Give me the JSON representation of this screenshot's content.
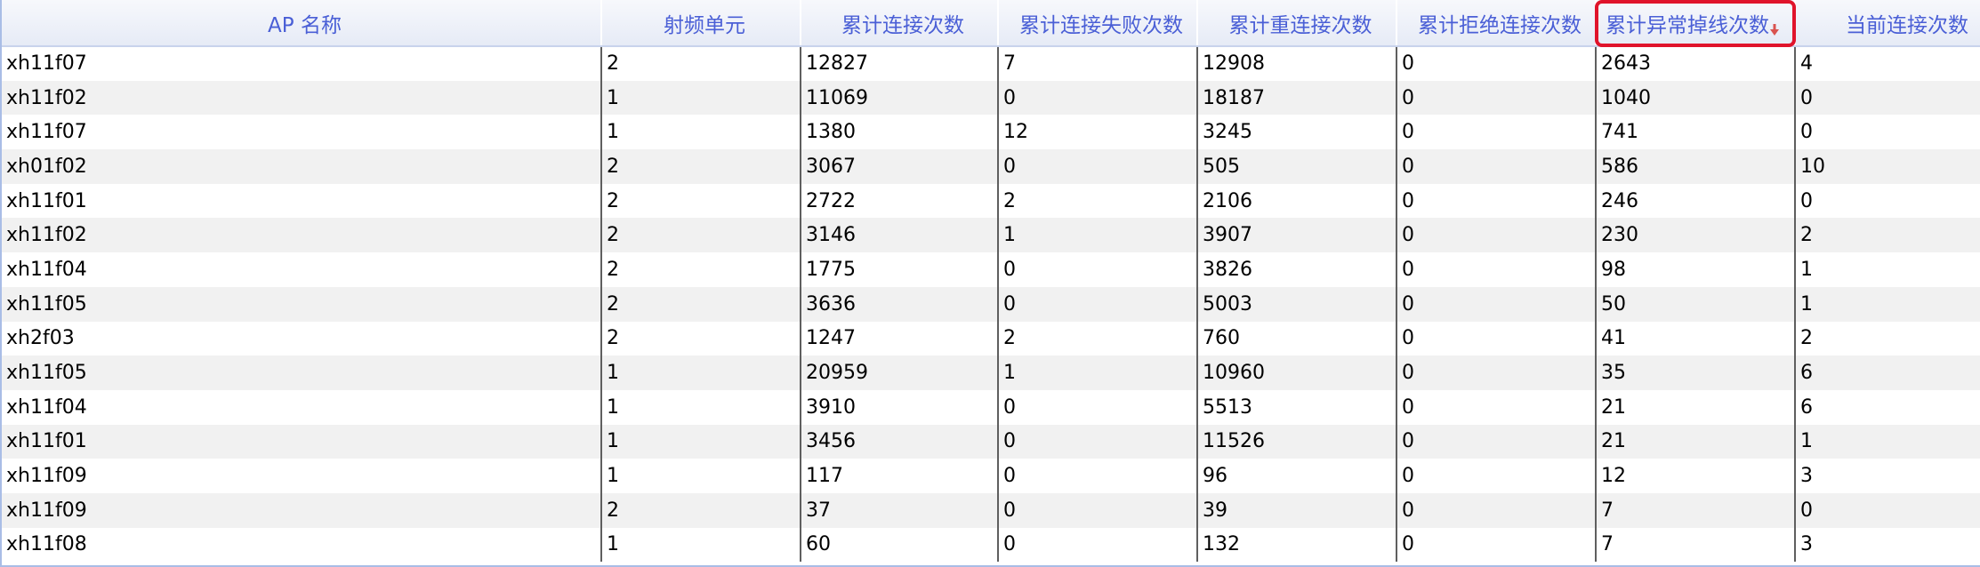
{
  "table": {
    "headers": [
      "AP 名称",
      "射频单元",
      "累计连接次数",
      "累计连接失败次数",
      "累计重连接次数",
      "累计拒绝连接次数",
      "累计异常掉线次数",
      "当前连接次数"
    ],
    "sorted_column": "累计异常掉线次数",
    "sort_direction": "descending",
    "sort_icon": "sort-down-arrow-icon",
    "colors": {
      "header_text": "#4a5fd6",
      "highlight": "#e0142b",
      "sort_arrow": "#d9534f"
    },
    "rows": [
      [
        "xh11f07",
        "2",
        "12827",
        "7",
        "12908",
        "0",
        "2643",
        "4"
      ],
      [
        "xh11f02",
        "1",
        "11069",
        "0",
        "18187",
        "0",
        "1040",
        "0"
      ],
      [
        "xh11f07",
        "1",
        "1380",
        "12",
        "3245",
        "0",
        "741",
        "0"
      ],
      [
        "xh01f02",
        "2",
        "3067",
        "0",
        "505",
        "0",
        "586",
        "10"
      ],
      [
        "xh11f01",
        "2",
        "2722",
        "2",
        "2106",
        "0",
        "246",
        "0"
      ],
      [
        "xh11f02",
        "2",
        "3146",
        "1",
        "3907",
        "0",
        "230",
        "2"
      ],
      [
        "xh11f04",
        "2",
        "1775",
        "0",
        "3826",
        "0",
        "98",
        "1"
      ],
      [
        "xh11f05",
        "2",
        "3636",
        "0",
        "5003",
        "0",
        "50",
        "1"
      ],
      [
        "xh2f03",
        "2",
        "1247",
        "2",
        "760",
        "0",
        "41",
        "2"
      ],
      [
        "xh11f05",
        "1",
        "20959",
        "1",
        "10960",
        "0",
        "35",
        "6"
      ],
      [
        "xh11f04",
        "1",
        "3910",
        "0",
        "5513",
        "0",
        "21",
        "6"
      ],
      [
        "xh11f01",
        "1",
        "3456",
        "0",
        "11526",
        "0",
        "21",
        "1"
      ],
      [
        "xh11f09",
        "1",
        "117",
        "0",
        "96",
        "0",
        "12",
        "3"
      ],
      [
        "xh11f09",
        "2",
        "37",
        "0",
        "39",
        "0",
        "7",
        "0"
      ],
      [
        "xh11f08",
        "1",
        "60",
        "0",
        "132",
        "0",
        "7",
        "3"
      ]
    ]
  }
}
